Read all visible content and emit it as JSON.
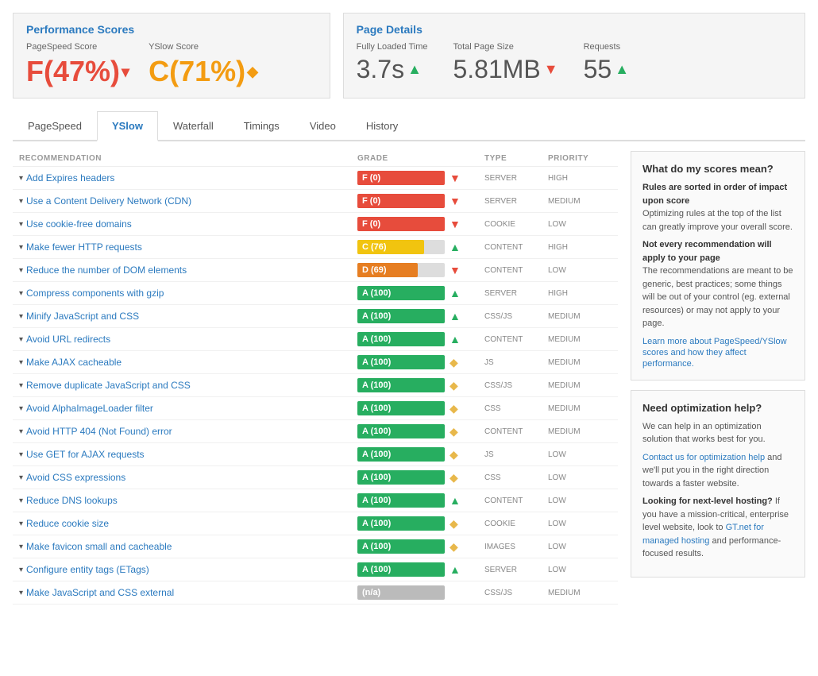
{
  "header": {
    "perf_title": "Performance Scores",
    "details_title": "Page Details"
  },
  "scores": {
    "pagespeed_label": "PageSpeed Score",
    "pagespeed_value": "F(47%)",
    "yslow_label": "YSlow Score",
    "yslow_value": "C(71%)"
  },
  "details": {
    "loaded_label": "Fully Loaded Time",
    "loaded_value": "3.7s",
    "size_label": "Total Page Size",
    "size_value": "5.81MB",
    "requests_label": "Requests",
    "requests_value": "55"
  },
  "tabs": [
    "PageSpeed",
    "YSlow",
    "Waterfall",
    "Timings",
    "Video",
    "History"
  ],
  "active_tab": "YSlow",
  "table_headers": {
    "recommendation": "RECOMMENDATION",
    "grade": "GRADE",
    "type": "TYPE",
    "priority": "PRIORITY"
  },
  "rows": [
    {
      "label": "Add Expires headers",
      "grade": "F (0)",
      "fill_pct": 0,
      "fill_class": "fill-red",
      "icon": "down",
      "type": "SERVER",
      "priority": "HIGH"
    },
    {
      "label": "Use a Content Delivery Network (CDN)",
      "grade": "F (0)",
      "fill_pct": 0,
      "fill_class": "fill-red",
      "icon": "down",
      "type": "SERVER",
      "priority": "MEDIUM"
    },
    {
      "label": "Use cookie-free domains",
      "grade": "F (0)",
      "fill_pct": 0,
      "fill_class": "fill-red",
      "icon": "down",
      "type": "COOKIE",
      "priority": "LOW"
    },
    {
      "label": "Make fewer HTTP requests",
      "grade": "C (76)",
      "fill_pct": 76,
      "fill_class": "fill-yellow",
      "icon": "up",
      "type": "CONTENT",
      "priority": "HIGH"
    },
    {
      "label": "Reduce the number of DOM elements",
      "grade": "D (69)",
      "fill_pct": 69,
      "fill_class": "fill-orange",
      "icon": "down",
      "type": "CONTENT",
      "priority": "LOW"
    },
    {
      "label": "Compress components with gzip",
      "grade": "A (100)",
      "fill_pct": 100,
      "fill_class": "fill-green",
      "icon": "up",
      "type": "SERVER",
      "priority": "HIGH"
    },
    {
      "label": "Minify JavaScript and CSS",
      "grade": "A (100)",
      "fill_pct": 100,
      "fill_class": "fill-green",
      "icon": "up",
      "type": "CSS/JS",
      "priority": "MEDIUM"
    },
    {
      "label": "Avoid URL redirects",
      "grade": "A (100)",
      "fill_pct": 100,
      "fill_class": "fill-green",
      "icon": "up",
      "type": "CONTENT",
      "priority": "MEDIUM"
    },
    {
      "label": "Make AJAX cacheable",
      "grade": "A (100)",
      "fill_pct": 100,
      "fill_class": "fill-green",
      "icon": "diamond",
      "type": "JS",
      "priority": "MEDIUM"
    },
    {
      "label": "Remove duplicate JavaScript and CSS",
      "grade": "A (100)",
      "fill_pct": 100,
      "fill_class": "fill-green",
      "icon": "diamond",
      "type": "CSS/JS",
      "priority": "MEDIUM"
    },
    {
      "label": "Avoid AlphaImageLoader filter",
      "grade": "A (100)",
      "fill_pct": 100,
      "fill_class": "fill-green",
      "icon": "diamond",
      "type": "CSS",
      "priority": "MEDIUM"
    },
    {
      "label": "Avoid HTTP 404 (Not Found) error",
      "grade": "A (100)",
      "fill_pct": 100,
      "fill_class": "fill-green",
      "icon": "diamond",
      "type": "CONTENT",
      "priority": "MEDIUM"
    },
    {
      "label": "Use GET for AJAX requests",
      "grade": "A (100)",
      "fill_pct": 100,
      "fill_class": "fill-green",
      "icon": "diamond",
      "type": "JS",
      "priority": "LOW"
    },
    {
      "label": "Avoid CSS expressions",
      "grade": "A (100)",
      "fill_pct": 100,
      "fill_class": "fill-green",
      "icon": "diamond",
      "type": "CSS",
      "priority": "LOW"
    },
    {
      "label": "Reduce DNS lookups",
      "grade": "A (100)",
      "fill_pct": 100,
      "fill_class": "fill-green",
      "icon": "up",
      "type": "CONTENT",
      "priority": "LOW"
    },
    {
      "label": "Reduce cookie size",
      "grade": "A (100)",
      "fill_pct": 100,
      "fill_class": "fill-green",
      "icon": "diamond",
      "type": "COOKIE",
      "priority": "LOW"
    },
    {
      "label": "Make favicon small and cacheable",
      "grade": "A (100)",
      "fill_pct": 100,
      "fill_class": "fill-green",
      "icon": "diamond",
      "type": "IMAGES",
      "priority": "LOW"
    },
    {
      "label": "Configure entity tags (ETags)",
      "grade": "A (100)",
      "fill_pct": 100,
      "fill_class": "fill-green",
      "icon": "up",
      "type": "SERVER",
      "priority": "LOW"
    },
    {
      "label": "Make JavaScript and CSS external",
      "grade": "(n/a)",
      "fill_pct": 0,
      "fill_class": "fill-gray",
      "icon": "none",
      "type": "CSS/JS",
      "priority": "MEDIUM"
    }
  ],
  "sidebar": {
    "box1_title": "What do my scores mean?",
    "box1_p1_bold": "Rules are sorted in order of impact upon score",
    "box1_p1": "Optimizing rules at the top of the list can greatly improve your overall score.",
    "box1_p2_bold": "Not every recommendation will apply to your page",
    "box1_p2": "The recommendations are meant to be generic, best practices; some things will be out of your control (eg. external resources) or may not apply to your page.",
    "box1_link_text": "Learn more about PageSpeed/YSlow scores and how they affect performance.",
    "box2_title": "Need optimization help?",
    "box2_p1": "We can help in an optimization solution that works best for you.",
    "box2_link1": "Contact us for optimization help",
    "box2_p2_mid": " and we'll put you in the right direction towards a faster website.",
    "box2_bold2": "Looking for next-level hosting?",
    "box2_p3": " If you have a mission-critical, enterprise level website, look to ",
    "box2_link2": "GT.net for managed hosting",
    "box2_p4": " and performance-focused results."
  }
}
